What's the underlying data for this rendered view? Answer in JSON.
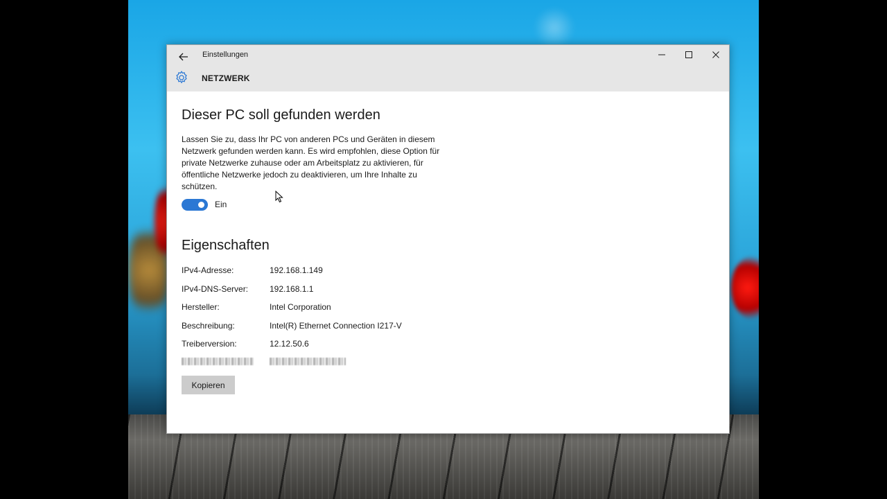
{
  "window": {
    "app_title": "Einstellungen",
    "section_title": "NETZWERK"
  },
  "discovery": {
    "heading": "Dieser PC soll gefunden werden",
    "description": "Lassen Sie zu, dass Ihr PC von anderen PCs und Geräten in diesem Netzwerk gefunden werden kann. Es wird empfohlen, diese Option für private Netzwerke zuhause oder am Arbeitsplatz zu aktivieren, für öffentliche Netzwerke jedoch zu deaktivieren, um Ihre Inhalte zu schützen.",
    "toggle_state": "Ein",
    "toggle_on": true
  },
  "properties": {
    "heading": "Eigenschaften",
    "rows": [
      {
        "key": "IPv4-Adresse:",
        "value": "192.168.1.149"
      },
      {
        "key": "IPv4-DNS-Server:",
        "value": "192.168.1.1"
      },
      {
        "key": "Hersteller:",
        "value": "Intel Corporation"
      },
      {
        "key": "Beschreibung:",
        "value": "Intel(R) Ethernet Connection I217-V"
      },
      {
        "key": "Treiberversion:",
        "value": "12.12.50.6"
      }
    ],
    "copy_label": "Kopieren"
  },
  "icons": {
    "back": "back-arrow-icon",
    "settings": "gear-icon",
    "minimize": "minimize-icon",
    "maximize": "maximize-icon",
    "close": "close-icon"
  },
  "colors": {
    "accent": "#2b78d4",
    "titlebar": "#e6e6e6",
    "button": "#cccccc"
  }
}
